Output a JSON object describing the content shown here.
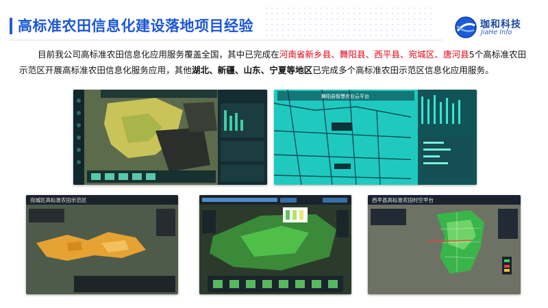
{
  "header": {
    "title": "高标准农田信息化建设落地项目经验"
  },
  "logo": {
    "name_cn": "珈和科技",
    "name_en": "JiaHe Info"
  },
  "intro": {
    "p1": "目前我公司高标准农田信息化应用服务覆盖全国，其中已完成在",
    "p2_red": "河南省新乡县、舞阳县、西平县、宛城区、唐河县",
    "p3": "5个高标准农田示范区开展高标准农田信息化服务应用，其他",
    "p4_bold": "湖北、新疆、山东、宁夏等地区",
    "p5": "已完成多个高标准农田示范区信息化应用服务。"
  },
  "screens": {
    "s2_title": "舞阳县智慧农业云平台",
    "s3_title": "宛城区高标准农田示范区",
    "s5_title": "西平县高标准农田时空平台"
  },
  "colors": {
    "title_blue": "#1a56d6",
    "highlight_red": "#e60012",
    "accent_blue": "#1e5bd8"
  }
}
